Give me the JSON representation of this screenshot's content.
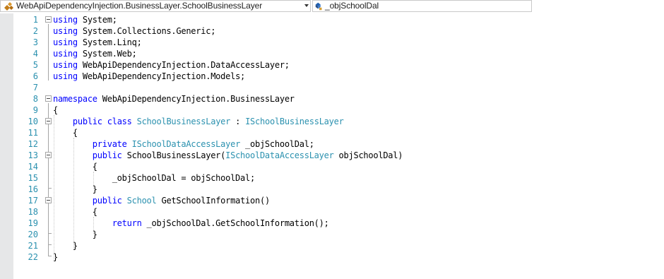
{
  "navbar": {
    "type_combo": "WebApiDependencyInjection.BusinessLayer.SchoolBusinessLayer",
    "member_combo": "_objSchoolDal"
  },
  "code": {
    "lines": [
      {
        "n": "1",
        "tokens": [
          {
            "t": "using",
            "c": "kw"
          },
          {
            "t": " System;",
            "c": ""
          }
        ]
      },
      {
        "n": "2",
        "tokens": [
          {
            "t": "using",
            "c": "kw"
          },
          {
            "t": " System.Collections.Generic;",
            "c": ""
          }
        ]
      },
      {
        "n": "3",
        "tokens": [
          {
            "t": "using",
            "c": "kw"
          },
          {
            "t": " System.Linq;",
            "c": ""
          }
        ]
      },
      {
        "n": "4",
        "tokens": [
          {
            "t": "using",
            "c": "kw"
          },
          {
            "t": " System.Web;",
            "c": ""
          }
        ]
      },
      {
        "n": "5",
        "tokens": [
          {
            "t": "using",
            "c": "kw"
          },
          {
            "t": " WebApiDependencyInjection.DataAccessLayer;",
            "c": ""
          }
        ]
      },
      {
        "n": "6",
        "tokens": [
          {
            "t": "using",
            "c": "kw"
          },
          {
            "t": " WebApiDependencyInjection.Models;",
            "c": ""
          }
        ]
      },
      {
        "n": "7",
        "tokens": []
      },
      {
        "n": "8",
        "tokens": [
          {
            "t": "namespace",
            "c": "kw"
          },
          {
            "t": " WebApiDependencyInjection.BusinessLayer",
            "c": ""
          }
        ]
      },
      {
        "n": "9",
        "tokens": [
          {
            "t": "{",
            "c": ""
          }
        ]
      },
      {
        "n": "10",
        "tokens": [
          {
            "t": "    ",
            "c": ""
          },
          {
            "t": "public",
            "c": "kw"
          },
          {
            "t": " ",
            "c": ""
          },
          {
            "t": "class",
            "c": "kw"
          },
          {
            "t": " ",
            "c": ""
          },
          {
            "t": "SchoolBusinessLayer",
            "c": "ty"
          },
          {
            "t": " : ",
            "c": ""
          },
          {
            "t": "ISchoolBusinessLayer",
            "c": "ty"
          }
        ]
      },
      {
        "n": "11",
        "tokens": [
          {
            "t": "    {",
            "c": ""
          }
        ]
      },
      {
        "n": "12",
        "tokens": [
          {
            "t": "        ",
            "c": ""
          },
          {
            "t": "private",
            "c": "kw"
          },
          {
            "t": " ",
            "c": ""
          },
          {
            "t": "ISchoolDataAccessLayer",
            "c": "ty"
          },
          {
            "t": " _objSchoolDal;",
            "c": ""
          }
        ]
      },
      {
        "n": "13",
        "tokens": [
          {
            "t": "        ",
            "c": ""
          },
          {
            "t": "public",
            "c": "kw"
          },
          {
            "t": " SchoolBusinessLayer(",
            "c": ""
          },
          {
            "t": "ISchoolDataAccessLayer",
            "c": "ty"
          },
          {
            "t": " objSchoolDal)",
            "c": ""
          }
        ]
      },
      {
        "n": "14",
        "tokens": [
          {
            "t": "        {",
            "c": ""
          }
        ]
      },
      {
        "n": "15",
        "tokens": [
          {
            "t": "            _objSchoolDal = objSchoolDal;",
            "c": ""
          }
        ]
      },
      {
        "n": "16",
        "tokens": [
          {
            "t": "        }",
            "c": ""
          }
        ]
      },
      {
        "n": "17",
        "tokens": [
          {
            "t": "        ",
            "c": ""
          },
          {
            "t": "public",
            "c": "kw"
          },
          {
            "t": " ",
            "c": ""
          },
          {
            "t": "School",
            "c": "ty"
          },
          {
            "t": " GetSchoolInformation()",
            "c": ""
          }
        ]
      },
      {
        "n": "18",
        "tokens": [
          {
            "t": "        {",
            "c": ""
          }
        ]
      },
      {
        "n": "19",
        "tokens": [
          {
            "t": "            ",
            "c": ""
          },
          {
            "t": "return",
            "c": "kw"
          },
          {
            "t": " _objSchoolDal.GetSchoolInformation();",
            "c": ""
          }
        ]
      },
      {
        "n": "20",
        "tokens": [
          {
            "t": "        }",
            "c": ""
          }
        ]
      },
      {
        "n": "21",
        "tokens": [
          {
            "t": "    }",
            "c": ""
          }
        ]
      },
      {
        "n": "22",
        "tokens": [
          {
            "t": "}",
            "c": ""
          }
        ]
      }
    ],
    "colors": {
      "keyword": "#0000ff",
      "type": "#2b91af",
      "line_number": "#2b91af",
      "text": "#000000"
    }
  }
}
